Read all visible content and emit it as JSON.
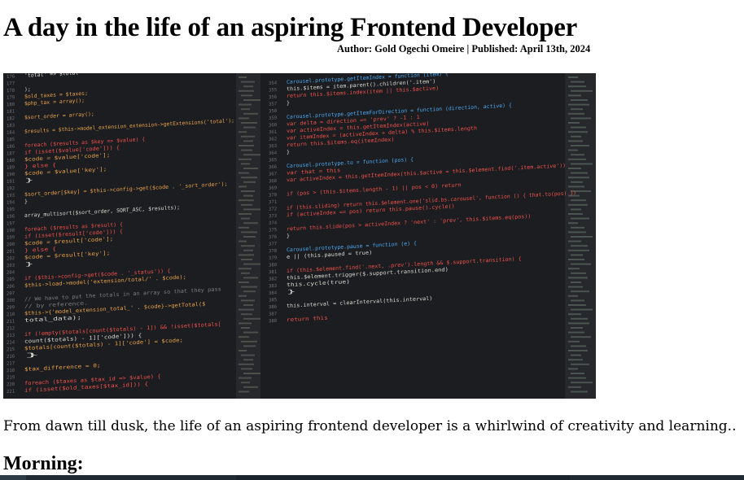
{
  "article": {
    "title": "A day in the life of an aspiring Frontend Developer",
    "byline": "Author: Gold Ogechi Omeire | Published: April 13th, 2024",
    "intro": "From dawn till dusk, the life of an aspiring frontend developer is a whirlwind of creativity and learning..",
    "section_heading": "Morning:"
  },
  "hero_code": {
    "left_lines": [
      "'total' => $total",
      "",
      ");",
      "$old_taxes = $taxes;",
      "$php_tax = array();",
      "",
      "$sort_order = array();",
      "",
      "$results = $this->model_extension_extension->getExtensions('total');",
      "",
      "foreach ($results as $key => $value) {",
      "  if (isset($value['code'])) {",
      "    $code = $value['code'];",
      "  } else {",
      "    $code = $value['key'];",
      "  }",
      "",
      "  $sort_order[$key] = $this->config->get($code . '_sort_order');",
      "}",
      "",
      "array_multisort($sort_order, SORT_ASC, $results);",
      "",
      "foreach ($results as $result) {",
      "  if (isset($result['code'])) {",
      "    $code = $result['code'];",
      "  } else {",
      "    $code = $result['key'];",
      "  }",
      "",
      "  if ($this->config->get($code . '_status')) {",
      "    $this->load->model('extension/total/' . $code);",
      "",
      "    // We have to put the totals in an array so that they pass",
      "    // by reference.",
      "    $this->{'model_extension_total_' . $code}->getTotal($",
      "      total_data);",
      "",
      "    if (!empty($totals[count($totals) - 1]) && !isset($totals[",
      "      count($totals) - 1]['code'])) {",
      "      $totals[count($totals) - 1]['code'] = $code;",
      "    }",
      "",
      "    $tax_difference = 0;",
      "",
      "    foreach ($taxes as $tax_id => $value) {",
      "      if (isset($old_taxes[$tax_id])) {"
    ],
    "right_lines": [
      "Carousel.prototype.getItemIndex = function (item) {",
      "  this.$items = item.parent().children('.item')",
      "  return this.$items.index(item || this.$active)",
      "}",
      "",
      "Carousel.prototype.getItemForDirection = function (direction, active) {",
      "  var delta = direction == 'prev' ? -1 : 1",
      "  var activeIndex = this.getItemIndex(active)",
      "  var itemIndex = (activeIndex + delta) % this.$items.length",
      "  return this.$items.eq(itemIndex)",
      "}",
      "",
      "Carousel.prototype.to = function (pos) {",
      "  var that = this",
      "  var activeIndex = this.getItemIndex(this.$active = this.$element.find('.item.active'))",
      "",
      "  if (pos > (this.$items.length - 1) || pos < 0) return",
      "",
      "  if (this.sliding)       return this.$element.one('slid.bs.carousel', function () { that.to(pos) })",
      "  if (activeIndex == pos) return this.pause().cycle()",
      "",
      "  return this.slide(pos > activeIndex ? 'next' : 'prev', this.$items.eq(pos))",
      "}",
      "",
      "Carousel.prototype.pause = function (e) {",
      "  e || (this.paused = true)",
      "",
      "  if (this.$element.find('.next, .prev').length && $.support.transition) {",
      "    this.$element.trigger($.support.transition.end)",
      "    this.cycle(true)",
      "  }",
      "",
      "  this.interval = clearInterval(this.interval)",
      "",
      "  return this"
    ],
    "left_start_line": 176,
    "right_start_line": 354,
    "colors": {
      "background": "#1c1d20",
      "gutter": "#6b6f75",
      "default": "#d8d8d0",
      "keyword": "#f0524c",
      "string": "#e6db74",
      "function": "#4aa8f0",
      "variable": "#e8a24a",
      "comment": "#7a7d80"
    }
  }
}
